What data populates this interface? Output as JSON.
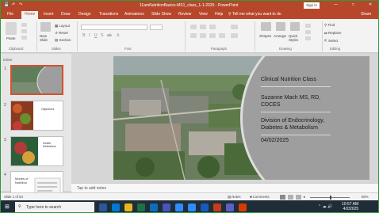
{
  "titlebar": {
    "title": "11amNutritionBasics-MS1_class_1-1-2025 - PowerPoint",
    "signin": "Sign in",
    "window_buttons": [
      "—",
      "□",
      "✕"
    ]
  },
  "tabs": [
    "File",
    "Home",
    "Insert",
    "Draw",
    "Design",
    "Transitions",
    "Animations",
    "Slide Show",
    "Review",
    "View",
    "Help"
  ],
  "tellme": "Tell me what you want to do",
  "share": "Share",
  "ribbon": {
    "groups": [
      "Clipboard",
      "Slides",
      "Font",
      "Paragraph",
      "Drawing",
      "Editing"
    ],
    "paste": "Paste",
    "new_slide": "New Slide",
    "layout": "Layout",
    "reset": "Reset",
    "section": "Section",
    "shapes": "Shapes",
    "arrange": "Arrange",
    "quick_styles": "Quick Styles",
    "find": "Find",
    "replace": "Replace",
    "select": "Select"
  },
  "left_panel": {
    "edit_label": "Editor",
    "thumbnails": [
      {
        "num": "1",
        "text": ""
      },
      {
        "num": "2",
        "text": "Objectives"
      },
      {
        "num": "3",
        "text": "Health Definitions"
      },
      {
        "num": "4",
        "text": "Modes of Nutrition"
      }
    ]
  },
  "slide": {
    "lines": [
      "Clinical Nutrition Class",
      "Suzanne Mach MS, RD,",
      "CDCES",
      "Division of Endocrinology,",
      "Diabetes & Metabolism",
      "04/02/2025"
    ]
  },
  "notes_placeholder": "Tap to add notes",
  "statusbar": {
    "slide_count": "Slide 1 of 54",
    "notes": "Notes",
    "comments": "Comments",
    "zoom": "55%"
  },
  "taskbar": {
    "search_placeholder": "Type here to search",
    "time": "10:57 AM",
    "date": "4/2/2025"
  },
  "colors": {
    "accent": "#b7472a",
    "slide_gray": "#9e9e9e",
    "taskbar": "#1f2d38"
  }
}
